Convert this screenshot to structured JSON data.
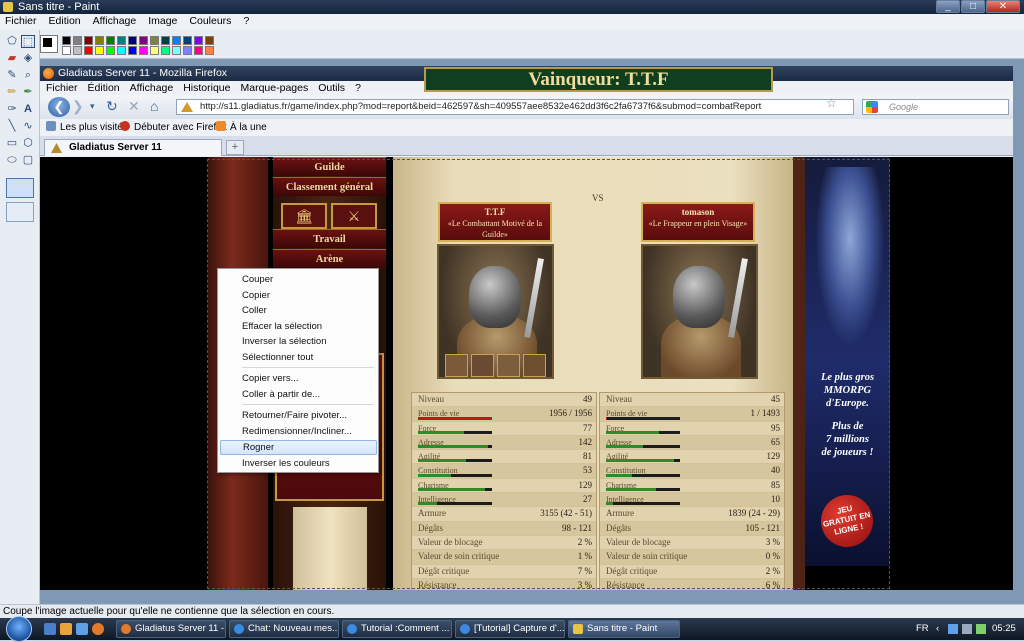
{
  "paint": {
    "window_title": "Sans titre - Paint",
    "window_controls": [
      "_",
      "□",
      "✕"
    ],
    "menu": [
      "Fichier",
      "Edition",
      "Affichage",
      "Image",
      "Couleurs",
      "?"
    ],
    "palette_colors": [
      "#000000",
      "#808080",
      "#800000",
      "#808000",
      "#008000",
      "#008080",
      "#000080",
      "#800080",
      "#808040",
      "#004040",
      "#0080ff",
      "#004080",
      "#8000ff",
      "#804000",
      "#ffffff",
      "#c0c0c0",
      "#ff0000",
      "#ffff00",
      "#00ff00",
      "#00ffff",
      "#0000ff",
      "#ff00ff",
      "#ffff80",
      "#00ff80",
      "#80ffff",
      "#8080ff",
      "#ff0080",
      "#ff8040"
    ],
    "status": "Coupe l'image actuelle pour qu'elle ne contienne que la sélection en cours."
  },
  "firefox": {
    "window_title": "Gladiatus Server 11 - Mozilla Firefox",
    "menu": [
      "Fichier",
      "Édition",
      "Affichage",
      "Historique",
      "Marque-pages",
      "Outils",
      "?"
    ],
    "url": "http://s11.gladiatus.fr/game/index.php?mod=report&beid=462597&sh=409557aee8532e462dd3f6c2fa6737f6&submod=combatReport",
    "search_placeholder": "Google",
    "bookmarks": [
      "Les plus visités",
      "Débuter avec Firefox",
      "À la une"
    ],
    "tab_title": "Gladiatus Server 11",
    "new_tab": "+"
  },
  "game": {
    "nav": [
      "Guilde",
      "Classement général",
      "Travail",
      "Arène"
    ],
    "winner": "Vainqueur: T.T.F",
    "vs": "VS",
    "fighters": [
      {
        "name": "T.T.F",
        "title": "«Le Combattant Motivé de la Guilde»"
      },
      {
        "name": "tomason",
        "title": "«Le Frappeur en plein Visage»"
      }
    ],
    "stats_left": [
      {
        "label": "Niveau",
        "value": "49"
      },
      {
        "label": "Points de vie",
        "value": "1956 / 1956",
        "bar": 1.0,
        "color": "red"
      },
      {
        "label": "Force",
        "value": "77",
        "bar": 0.62
      },
      {
        "label": "Adresse",
        "value": "142",
        "bar": 0.95
      },
      {
        "label": "Agilité",
        "value": "81",
        "bar": 0.65
      },
      {
        "label": "Constitution",
        "value": "53",
        "bar": 0.45
      },
      {
        "label": "Charisme",
        "value": "129",
        "bar": 0.9
      },
      {
        "label": "Intelligence",
        "value": "27",
        "bar": 0.25
      },
      {
        "label": "Armure",
        "value": "3155 (42 - 51)"
      },
      {
        "label": "Dégâts",
        "value": "98 - 121"
      },
      {
        "label": "Valeur de blocage",
        "value": "2 %"
      },
      {
        "label": "Valeur de soin critique",
        "value": "1 %"
      },
      {
        "label": "Dégât critique",
        "value": "7 %"
      },
      {
        "label": "Résistance",
        "value": "3 %"
      }
    ],
    "stats_right": [
      {
        "label": "Niveau",
        "value": "45"
      },
      {
        "label": "Points de vie",
        "value": "1 / 1493",
        "bar": 0.01,
        "color": "red"
      },
      {
        "label": "Force",
        "value": "95",
        "bar": 0.72
      },
      {
        "label": "Adresse",
        "value": "65",
        "bar": 0.5
      },
      {
        "label": "Agilité",
        "value": "129",
        "bar": 0.92
      },
      {
        "label": "Constitution",
        "value": "40",
        "bar": 0.35
      },
      {
        "label": "Charisme",
        "value": "85",
        "bar": 0.68
      },
      {
        "label": "Intelligence",
        "value": "10",
        "bar": 0.1
      },
      {
        "label": "Armure",
        "value": "1839 (24 - 29)"
      },
      {
        "label": "Dégâts",
        "value": "105 - 121"
      },
      {
        "label": "Valeur de blocage",
        "value": "3 %"
      },
      {
        "label": "Valeur de soin critique",
        "value": "0 %"
      },
      {
        "label": "Dégât critique",
        "value": "2 %"
      },
      {
        "label": "Résistance",
        "value": "6 %"
      }
    ],
    "ad": {
      "text": "Le plus gros MMORPG d'Europe. Plus de 7 millions de joueurs !",
      "line1": "Le plus gros",
      "line2": "MMORPG",
      "line3": "d'Europe.",
      "line4": "Plus de",
      "line5": "7 millions",
      "line6": "de joueurs !",
      "badge": "JEU GRATUIT EN LIGNE !"
    }
  },
  "context_menu": {
    "items": [
      "Couper",
      "Copier",
      "Coller",
      "Effacer la sélection",
      "Inverser la sélection",
      "Sélectionner tout",
      "Copier vers...",
      "Coller à partir de...",
      "Retourner/Faire pivoter...",
      "Redimensionner/Incliner...",
      "Rogner",
      "Inverser les couleurs"
    ],
    "highlighted": "Rogner"
  },
  "taskbar": {
    "tasks": [
      "Gladiatus Server 11 - ...",
      "Chat: Nouveau mes...",
      "Tutorial :Comment ...",
      "[Tutorial] Capture d'...",
      "Sans titre - Paint"
    ],
    "active": "Sans titre - Paint",
    "lang": "FR",
    "time": "05:25"
  },
  "colors": {
    "accent": "#2a5da8",
    "winner_bg": "#0f3f1e",
    "highlight": "#d4e6fb"
  }
}
